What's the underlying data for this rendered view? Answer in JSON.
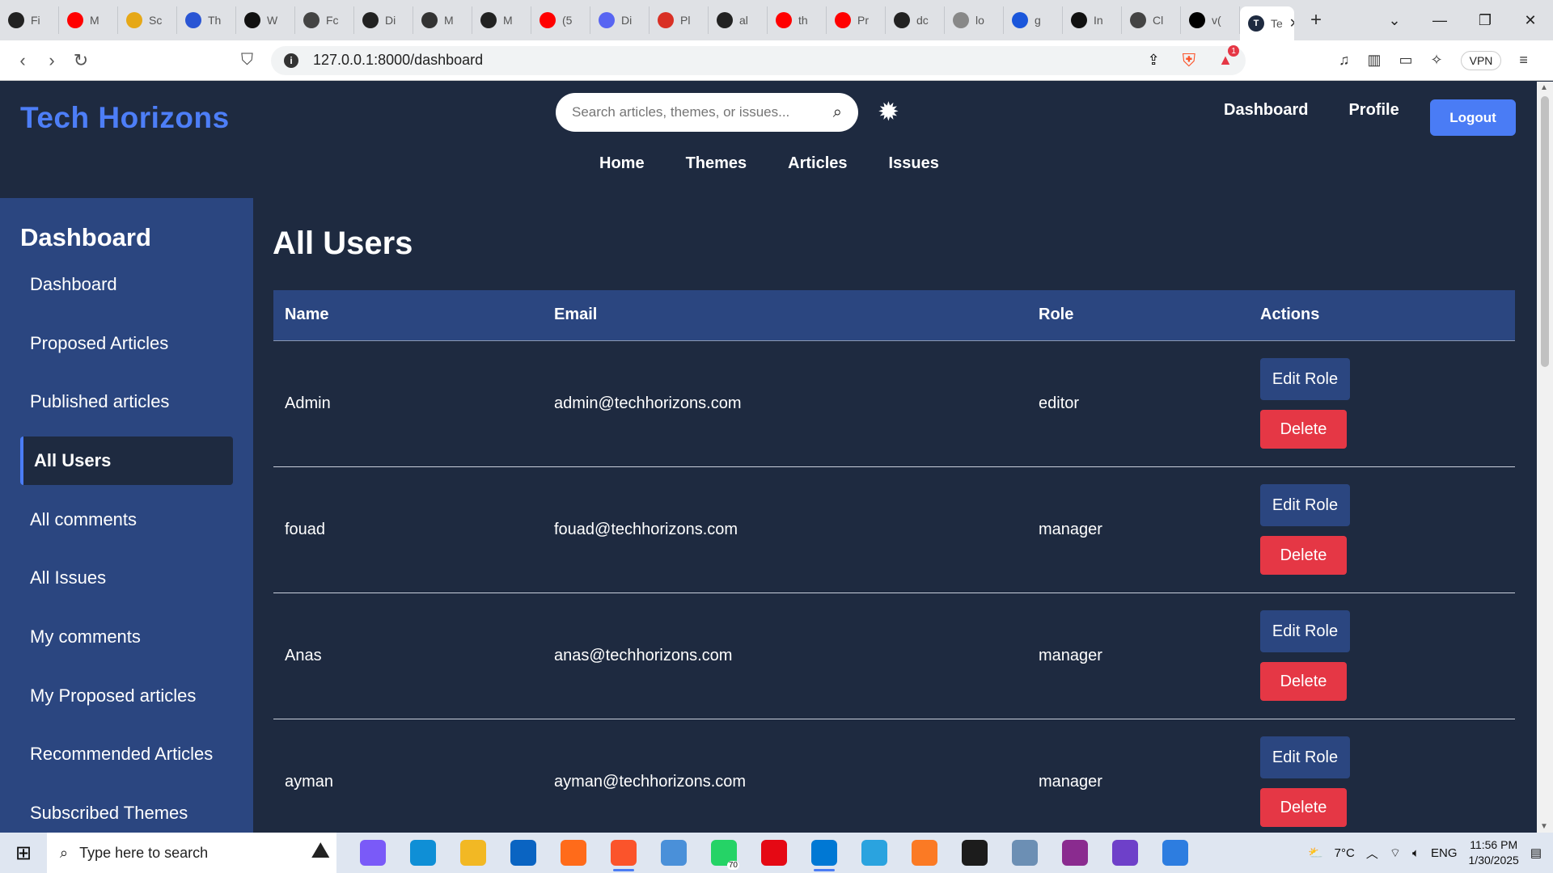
{
  "browser": {
    "tabs": [
      {
        "icon": "github-icon",
        "label": "Fi",
        "color": "#222222"
      },
      {
        "icon": "youtube-icon",
        "label": "M",
        "color": "#ff0000"
      },
      {
        "icon": "app-icon",
        "label": "Sc",
        "color": "#e6a817"
      },
      {
        "icon": "power-icon",
        "label": "Th",
        "color": "#2a55d4"
      },
      {
        "icon": "medium-icon",
        "label": "W",
        "color": "#111111"
      },
      {
        "icon": "openai-icon",
        "label": "Fc",
        "color": "#444444"
      },
      {
        "icon": "github-icon",
        "label": "Di",
        "color": "#222222"
      },
      {
        "icon": "app-icon",
        "label": "M",
        "color": "#333333"
      },
      {
        "icon": "github-icon",
        "label": "M",
        "color": "#222222"
      },
      {
        "icon": "youtube-icon",
        "label": "(5",
        "color": "#ff0000"
      },
      {
        "icon": "app-icon",
        "label": "Di",
        "color": "#5865f2"
      },
      {
        "icon": "app-icon",
        "label": "Pl",
        "color": "#d93025"
      },
      {
        "icon": "github-icon",
        "label": "al",
        "color": "#222222"
      },
      {
        "icon": "youtube-icon",
        "label": "th",
        "color": "#ff0000"
      },
      {
        "icon": "youtube-icon",
        "label": "Pr",
        "color": "#ff0000"
      },
      {
        "icon": "github-icon",
        "label": "dc",
        "color": "#222222"
      },
      {
        "icon": "app-icon",
        "label": "lo",
        "color": "#888888"
      },
      {
        "icon": "app-icon",
        "label": "g",
        "color": "#1a56db"
      },
      {
        "icon": "openai-icon",
        "label": "In",
        "color": "#111111"
      },
      {
        "icon": "openai-icon",
        "label": "Cl",
        "color": "#444444"
      },
      {
        "icon": "app-icon",
        "label": "v(",
        "color": "#000000"
      }
    ],
    "active_tab": {
      "label": "Te",
      "close": "✕"
    },
    "new_tab": "+",
    "window_controls": {
      "dropdown": "⌄",
      "minimize": "—",
      "restore": "❐",
      "close": "✕"
    },
    "address": "127.0.0.1:8000/dashboard",
    "vpn": "VPN",
    "brave_badge": "1"
  },
  "site": {
    "brand": "Tech Horizons",
    "search_placeholder": "Search articles, themes, or issues...",
    "top_links": [
      "Dashboard",
      "Profile"
    ],
    "logout": "Logout",
    "main_nav": [
      "Home",
      "Themes",
      "Articles",
      "Issues"
    ]
  },
  "sidebar": {
    "title": "Dashboard",
    "items": [
      {
        "label": "Dashboard",
        "active": false
      },
      {
        "label": "Proposed Articles",
        "active": false
      },
      {
        "label": "Published articles",
        "active": false
      },
      {
        "label": "All Users",
        "active": true
      },
      {
        "label": "All comments",
        "active": false
      },
      {
        "label": "All Issues",
        "active": false
      },
      {
        "label": "My comments",
        "active": false
      },
      {
        "label": "My Proposed articles",
        "active": false
      },
      {
        "label": "Recommended Articles",
        "active": false
      },
      {
        "label": "Subscribed Themes",
        "active": false
      }
    ]
  },
  "main": {
    "title": "All Users",
    "columns": [
      "Name",
      "Email",
      "Role",
      "Actions"
    ],
    "rows": [
      {
        "name": "Admin",
        "email": "admin@techhorizons.com",
        "role": "editor"
      },
      {
        "name": "fouad",
        "email": "fouad@techhorizons.com",
        "role": "manager"
      },
      {
        "name": "Anas",
        "email": "anas@techhorizons.com",
        "role": "manager"
      },
      {
        "name": "ayman",
        "email": "ayman@techhorizons.com",
        "role": "manager"
      }
    ],
    "edit_label": "Edit Role",
    "delete_label": "Delete"
  },
  "taskbar": {
    "search_placeholder": "Type here to search",
    "apps": [
      {
        "name": "copilot-icon",
        "color": "#7a5af8"
      },
      {
        "name": "edge-icon",
        "color": "#0f8fd6"
      },
      {
        "name": "file-explorer-icon",
        "color": "#f2b824"
      },
      {
        "name": "outlook-icon",
        "color": "#0a64c2"
      },
      {
        "name": "firefox-icon",
        "color": "#ff6b1a"
      },
      {
        "name": "brave-icon",
        "color": "#fb542b",
        "running": true
      },
      {
        "name": "qbittorrent-icon",
        "color": "#4a90d9"
      },
      {
        "name": "whatsapp-icon",
        "color": "#25d366",
        "badge": "70"
      },
      {
        "name": "netflix-icon",
        "color": "#e50914"
      },
      {
        "name": "vscode-icon",
        "color": "#0078d4",
        "running": true
      },
      {
        "name": "telegram-icon",
        "color": "#2aa3df"
      },
      {
        "name": "xampp-icon",
        "color": "#fb7a24"
      },
      {
        "name": "terminal-icon",
        "color": "#1c1c1c"
      },
      {
        "name": "image-viewer-icon",
        "color": "#6c8fb4"
      },
      {
        "name": "winrar-icon",
        "color": "#8a2b8f"
      },
      {
        "name": "github-desktop-icon",
        "color": "#6e40c9"
      },
      {
        "name": "photos-icon",
        "color": "#2d7de0"
      }
    ],
    "weather": "7°C",
    "language": "ENG",
    "time": "11:56 PM",
    "date": "1/30/2025"
  }
}
